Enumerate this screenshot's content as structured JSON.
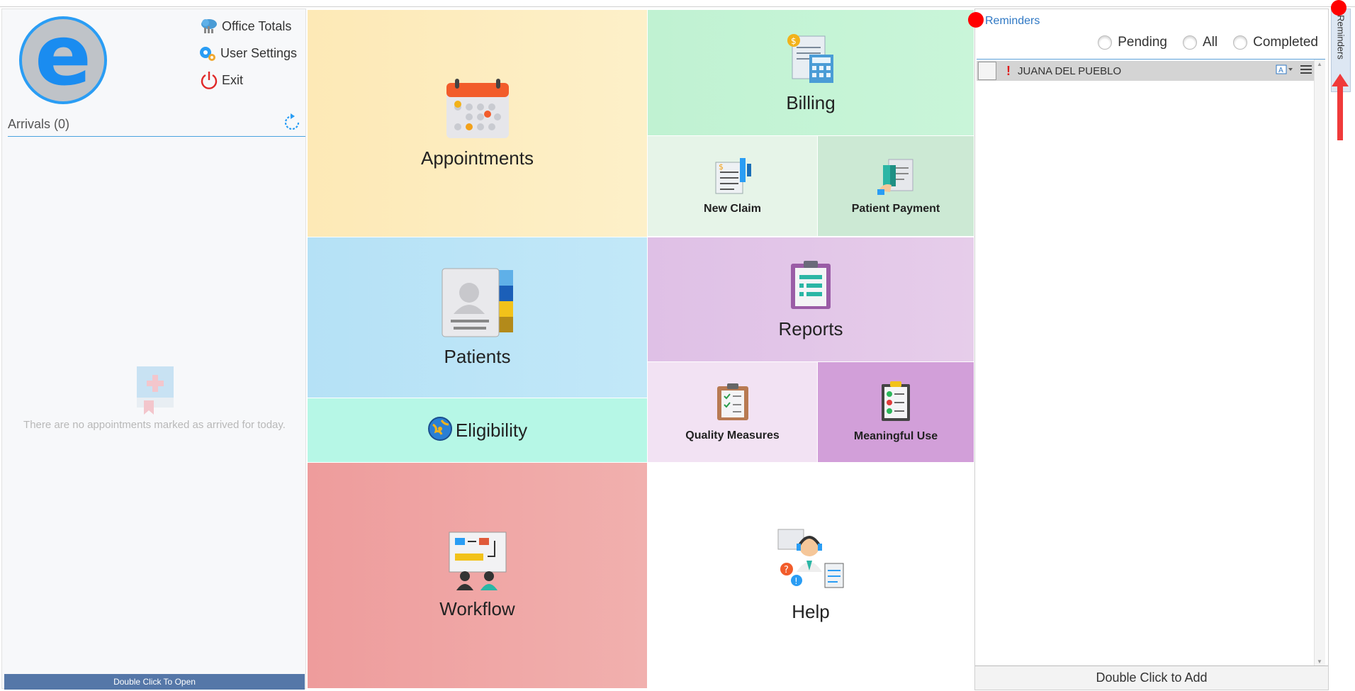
{
  "left": {
    "office_totals": "Office Totals",
    "user_settings": "User Settings",
    "exit": "Exit",
    "arrivals": "Arrivals (0)",
    "empty_message": "There are no appointments marked as arrived for today.",
    "open_bar": "Double Click To Open"
  },
  "tiles": {
    "appointments": "Appointments",
    "billing": "Billing",
    "new_claim": "New Claim",
    "patient_payment": "Patient Payment",
    "patients": "Patients",
    "eligibility": "Eligibility",
    "reports": "Reports",
    "quality_measures": "Quality Measures",
    "meaningful_use": "Meaningful Use",
    "workflow": "Workflow",
    "help": "Help"
  },
  "reminders": {
    "title": "Reminders",
    "filters": [
      "Pending",
      "All",
      "Completed"
    ],
    "items": [
      {
        "name": "JUANA DEL PUEBLO"
      }
    ],
    "footer": "Double Click to Add",
    "side_tab": "Reminders"
  },
  "colors": {
    "appointments": "#fdeebf",
    "billing": "#c4f3d5",
    "new_claim": "#e8f5ea",
    "patient_payment": "#cce9d4",
    "patients": "#b9e4f7",
    "eligibility": "#b6f7e6",
    "reports": "#e4c6e8",
    "quality_measures": "#f2e4f3",
    "meaningful_use": "#d29fd9",
    "workflow": "#f0a9a9",
    "help": "#ffffff",
    "accent": "#2f78c4"
  }
}
